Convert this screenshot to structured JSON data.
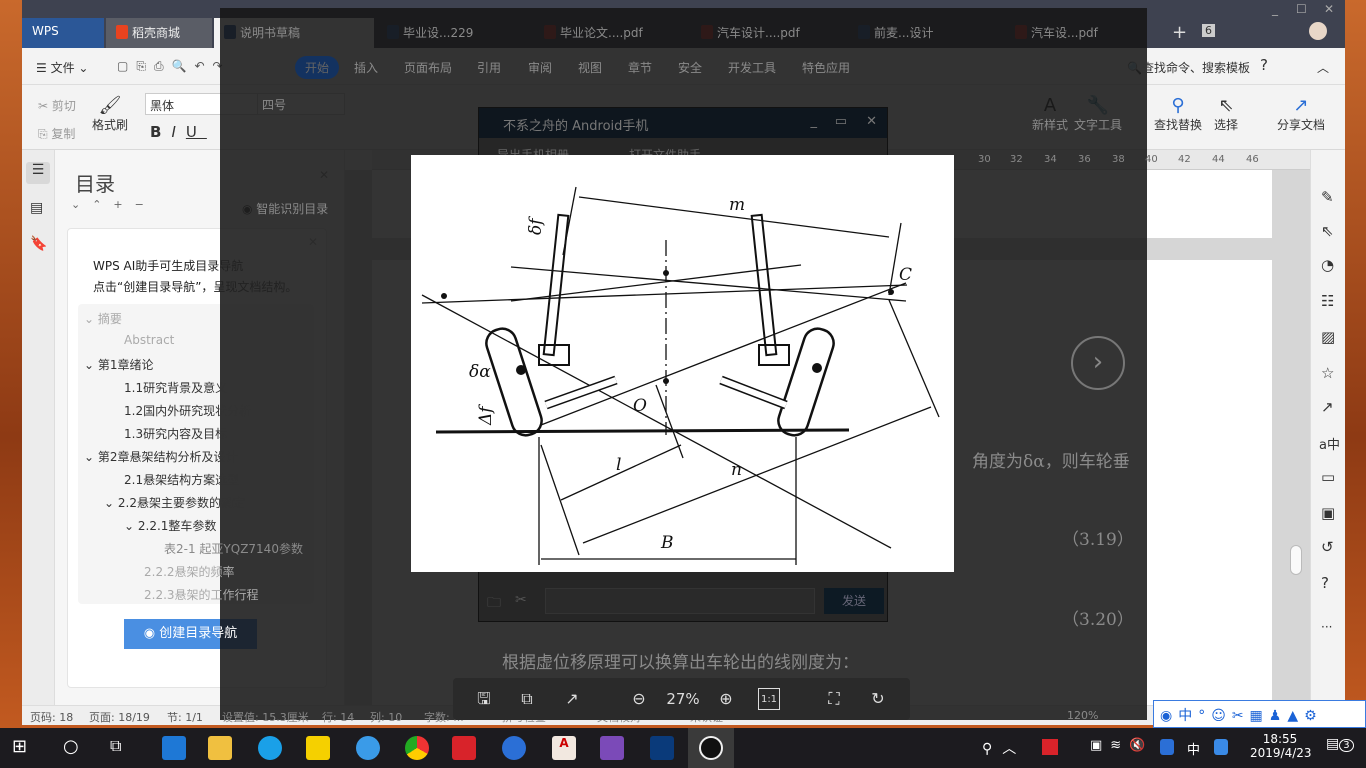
{
  "tabs": [
    {
      "label": "WPS",
      "color": "#2b5797"
    },
    {
      "label": "稻壳商城",
      "color": "#e8431f"
    },
    {
      "label": "说明书草稿",
      "color": "#2b5797",
      "active": true
    },
    {
      "label": "毕业设...229",
      "color": "#2b5797"
    },
    {
      "label": "毕业论文....pdf",
      "color": "#d0342c"
    },
    {
      "label": "汽车设计....pdf",
      "color": "#d0342c"
    },
    {
      "label": "前麦...设计",
      "color": "#2b5797"
    },
    {
      "label": "汽车设...pdf",
      "color": "#d0342c"
    }
  ],
  "tab_count": "6",
  "menu": {
    "file": "文件",
    "items": [
      "开始",
      "插入",
      "页面布局",
      "引用",
      "审阅",
      "视图",
      "章节",
      "安全",
      "开发工具",
      "特色应用"
    ],
    "active": "开始",
    "search": "查找命令、搜索模板",
    "help": "?"
  },
  "ribbon": {
    "cut": "剪切",
    "copy": "复制",
    "format_painter": "格式刷",
    "font": "黑体",
    "size": "四号",
    "new_style": "新样式",
    "text_tools": "文字工具",
    "find_replace": "查找替换",
    "select": "选择",
    "share": "分享文档"
  },
  "sidebar": {
    "title": "目录",
    "smart": "智能识别目录",
    "ai_line1": "WPS AI助手可生成目录导航",
    "ai_line2": "点击“创建目录导航”，呈现文档结构。",
    "toc": [
      {
        "label": "摘要",
        "level": 0,
        "expanded": true,
        "faded": true
      },
      {
        "label": "Abstract",
        "level": 1,
        "faded": true
      },
      {
        "label": "第1章绪论",
        "level": 0,
        "expanded": true
      },
      {
        "label": "1.1研究背景及意义",
        "level": 1
      },
      {
        "label": "1.2国内外研究现状分析",
        "level": 1
      },
      {
        "label": "1.3研究内容及目标",
        "level": 1
      },
      {
        "label": "第2章悬架结构分析及设计",
        "level": 0,
        "expanded": true
      },
      {
        "label": "2.1悬架结构方案选型",
        "level": 1
      },
      {
        "label": "2.2悬架主要参数的确定",
        "level": 1,
        "expanded": true
      },
      {
        "label": "2.2.1整车参数",
        "level": 2,
        "expanded": true
      },
      {
        "label": "表2-1 起亚YQZ7140参数",
        "level": 3
      },
      {
        "label": "2.2.2悬架的频率",
        "level": 2,
        "faded": true
      },
      {
        "label": "2.2.3悬架的工作行程",
        "level": 2,
        "faded": true
      }
    ],
    "create_button": "创建目录导航"
  },
  "ruler": [
    "30",
    "32",
    "34",
    "36",
    "38",
    "40",
    "42",
    "44",
    "46"
  ],
  "document": {
    "line1": "角度为δα，则车轮垂",
    "eq1": "（3.19）",
    "eq2": "（3.20）",
    "line2": "根据虚位移原理可以换算出车轮出的线刚度为："
  },
  "qq": {
    "title": "不系之舟的 Android手机",
    "tool1": "导出手机相册",
    "tool2": "打开文件助手",
    "send": "发送"
  },
  "diagram": {
    "labels": {
      "m": "m",
      "C": "C",
      "df": "δf",
      "da": "δα",
      "Df": "Δf",
      "O": "O",
      "l": "l",
      "n": "n",
      "B": "B"
    }
  },
  "viewer": {
    "zoom": "27%",
    "actual_size": "1:1"
  },
  "status": {
    "page": "页码: 18",
    "pages": "页面: 18/19",
    "section": "节: 1/1",
    "setting": "设置值: 15.3厘米",
    "row": "行: 14",
    "col": "列: 10",
    "words": "字数: ...",
    "spell": "拼写检查",
    "proof": "文档校对",
    "cert": "未认证",
    "zoom": "120%"
  },
  "ime": {
    "lang": "中"
  },
  "taskbar": {
    "time": "18:55",
    "date": "2019/4/23",
    "ime": "中",
    "notifications": "3"
  }
}
